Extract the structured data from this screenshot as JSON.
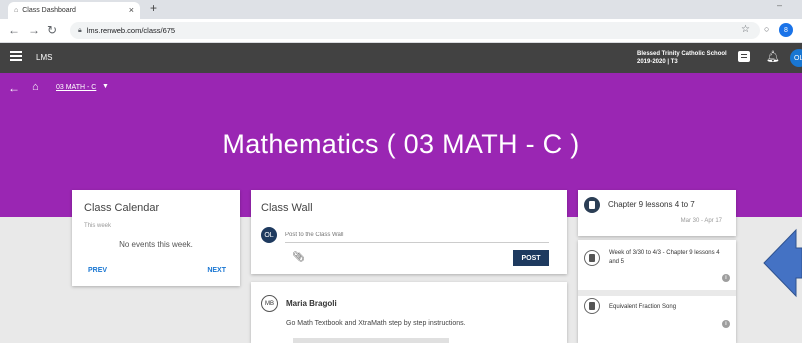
{
  "browser": {
    "tab_title": "Class Dashboard",
    "tab_close": "×",
    "new_tab": "+",
    "url": "lms.renweb.com/class/675",
    "profile_initial": "8"
  },
  "appbar": {
    "title": "LMS",
    "school_name": "Blessed Trinity Catholic School",
    "term": "2019-2020 | T3",
    "user_initials": "OL"
  },
  "header": {
    "breadcrumb": "03 MATH - C",
    "course_title": "Mathematics ( 03 MATH - C )",
    "color": "#9a26b3"
  },
  "calendar": {
    "title": "Class Calendar",
    "subtitle": "This week",
    "empty_text": "No events this week.",
    "prev_label": "PREV",
    "next_label": "NEXT"
  },
  "class_wall": {
    "title": "Class Wall",
    "user_initials": "OL",
    "placeholder": "Post to the Class Wall",
    "post_label": "POST"
  },
  "wall_post": {
    "author_initials": "MB",
    "author": "Maria Bragoli",
    "body": "Go Math Textbook and XtraMath step by step instructions."
  },
  "module": {
    "title": "Chapter 9 lessons 4 to 7",
    "dates": "Mar 30  -  Apr 17",
    "items": [
      {
        "label": "Week of 3/30 to 4/3 - Chapter 9 lessons 4 and 5"
      },
      {
        "label": "Equivalent Fraction Song"
      }
    ]
  },
  "colors": {
    "appbar": "#424242",
    "accent_blue": "#1976d2",
    "navy": "#1e3a5f",
    "arrow": "#4472c4"
  }
}
